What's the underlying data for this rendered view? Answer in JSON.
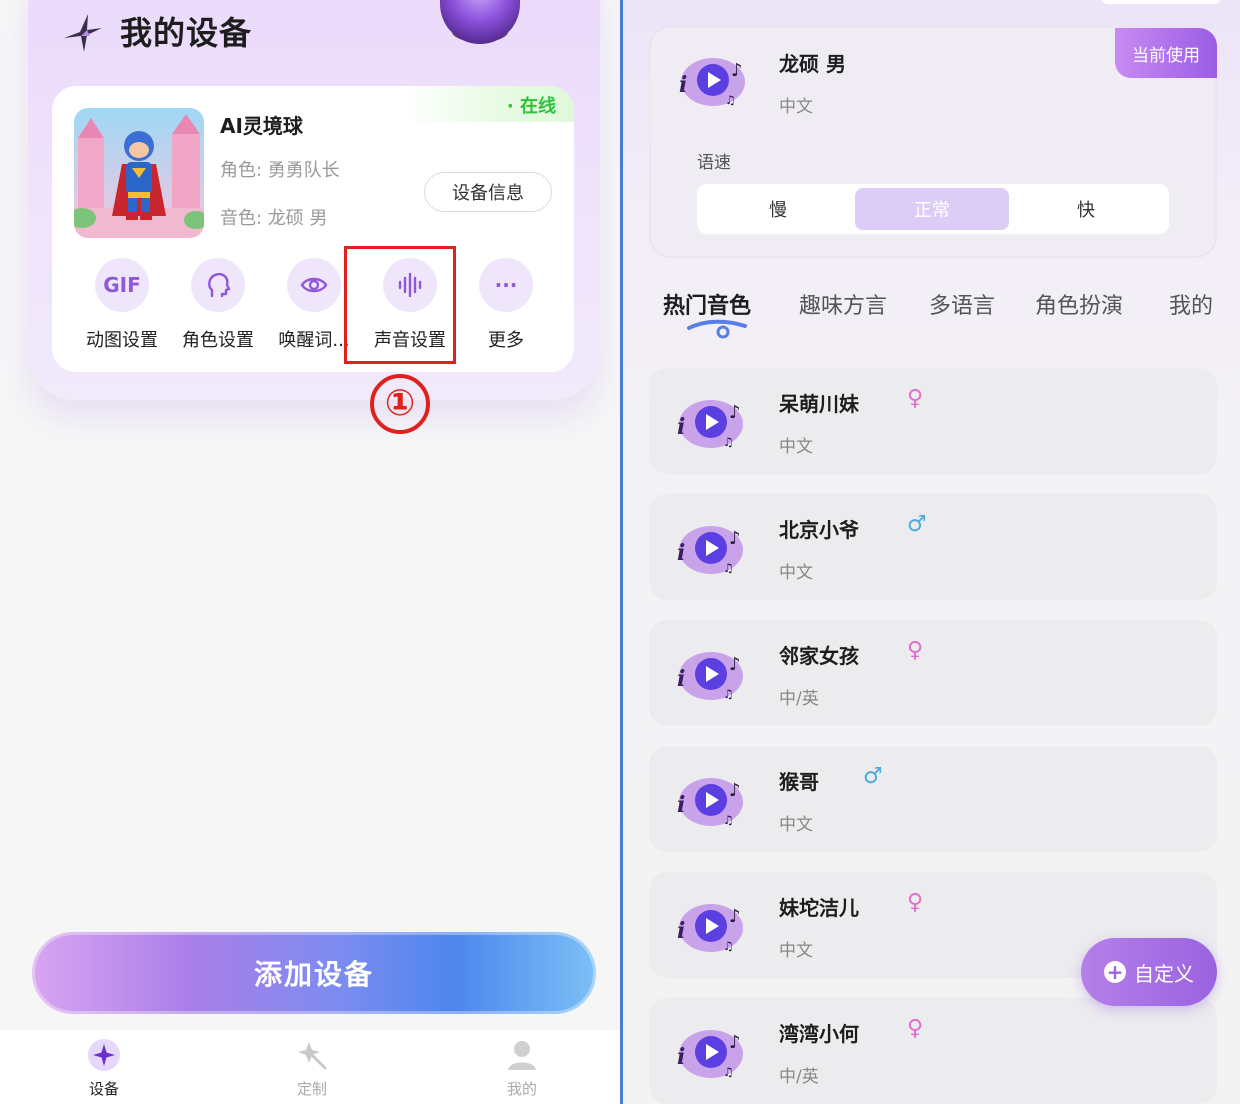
{
  "left": {
    "page_title": "我的设备",
    "device": {
      "status": "· 在线",
      "name": "AI灵境球",
      "role": "角色: 勇勇队长",
      "voice": "音色: 龙硕 男",
      "info_button": "设备信息"
    },
    "tools": [
      {
        "label": "动图设置",
        "icon": "gif-icon",
        "icon_text": "GIF"
      },
      {
        "label": "角色设置",
        "icon": "head-profile-icon"
      },
      {
        "label": "唤醒词...",
        "icon": "eye-icon"
      },
      {
        "label": "声音设置",
        "icon": "sound-wave-icon"
      },
      {
        "label": "更多",
        "icon": "more-dots-icon",
        "icon_text": "···"
      }
    ],
    "step_marker": "①",
    "add_button": "添加设备",
    "tabbar": [
      {
        "label": "设备",
        "icon": "sparkle-icon",
        "active": true
      },
      {
        "label": "定制",
        "icon": "magic-wand-icon",
        "active": false
      },
      {
        "label": "我的",
        "icon": "user-icon",
        "active": false
      }
    ]
  },
  "right": {
    "current": {
      "name": "龙硕 男",
      "lang": "中文",
      "badge": "当前使用",
      "speed_label": "语速",
      "speed_options": [
        "慢",
        "正常",
        "快"
      ],
      "speed_selected": "正常"
    },
    "categories": [
      "热门音色",
      "趣味方言",
      "多语言",
      "角色扮演",
      "我的"
    ],
    "active_category": "热门音色",
    "voices": [
      {
        "name": "呆萌川妹",
        "gender": "♀",
        "gender_type": "female",
        "lang": "中文"
      },
      {
        "name": "北京小爷",
        "gender": "♂",
        "gender_type": "male",
        "lang": "中文"
      },
      {
        "name": "邻家女孩",
        "gender": "♀",
        "gender_type": "female",
        "lang": "中/英"
      },
      {
        "name": "猴哥",
        "gender": "♂",
        "gender_type": "male",
        "lang": "中文"
      },
      {
        "name": "妹坨洁儿",
        "gender": "♀",
        "gender_type": "female",
        "lang": "中文"
      },
      {
        "name": "湾湾小何",
        "gender": "♀",
        "gender_type": "female",
        "lang": "中/英"
      }
    ],
    "custom_button": "自定义"
  },
  "colors": {
    "accent_purple": "#9a63e0",
    "online_green": "#2ec23b",
    "highlight_red": "#e0201c",
    "divider_blue": "#4b7bd8"
  }
}
